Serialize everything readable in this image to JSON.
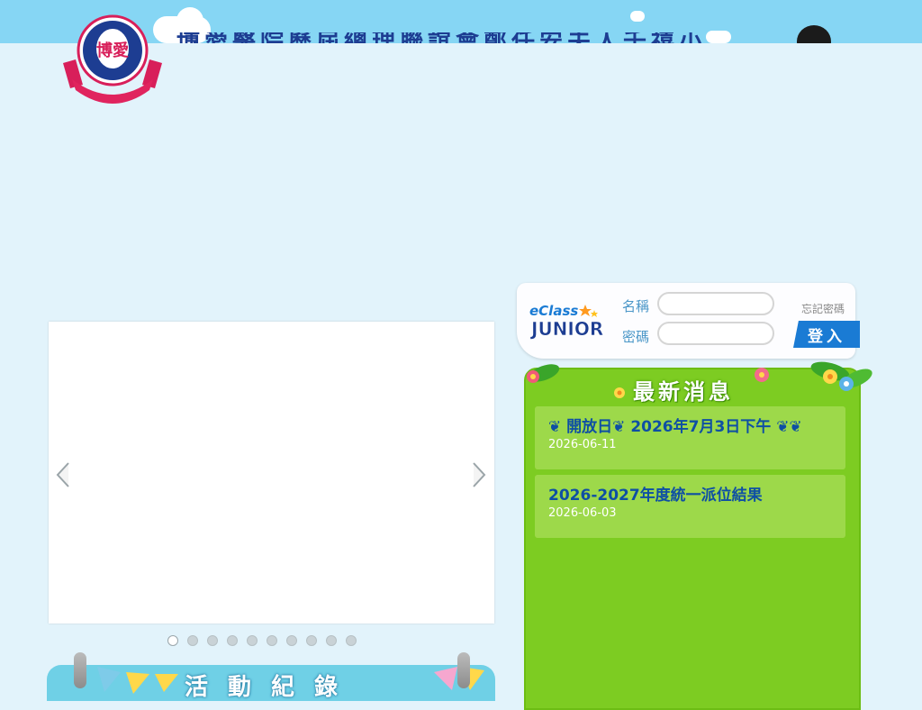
{
  "header": {
    "school_name": "博愛醫院歷屆總理聯誼會鄭任安夫人千禧小學",
    "logo_text": "博愛"
  },
  "slider": {
    "prev_icon": "chevron-left-icon",
    "next_icon": "chevron-right-icon",
    "slide_count": 10,
    "active_index": 0
  },
  "activity": {
    "title": "活動紀錄"
  },
  "login": {
    "logo_top": "eClass",
    "logo_bottom": "JUNIOR",
    "username_label": "名稱",
    "password_label": "密碼",
    "username_value": "",
    "password_value": "",
    "forgot_label": "忘記密碼",
    "submit_label": "登入"
  },
  "news": {
    "title": "最新消息",
    "items": [
      {
        "title": "❦ 開放日❦ 2026年7月3日下午 ❦❦",
        "date": "2026-06-11"
      },
      {
        "title": "2026-2027年度統一派位結果",
        "date": "2026-06-03"
      }
    ]
  },
  "colors": {
    "sky": "#86d6f4",
    "page_bg": "#e2f3fb",
    "news_green": "#7dcc22",
    "news_item": "#9dd94a",
    "link_blue": "#0e4fa4",
    "button_blue": "#1a7bd4"
  }
}
